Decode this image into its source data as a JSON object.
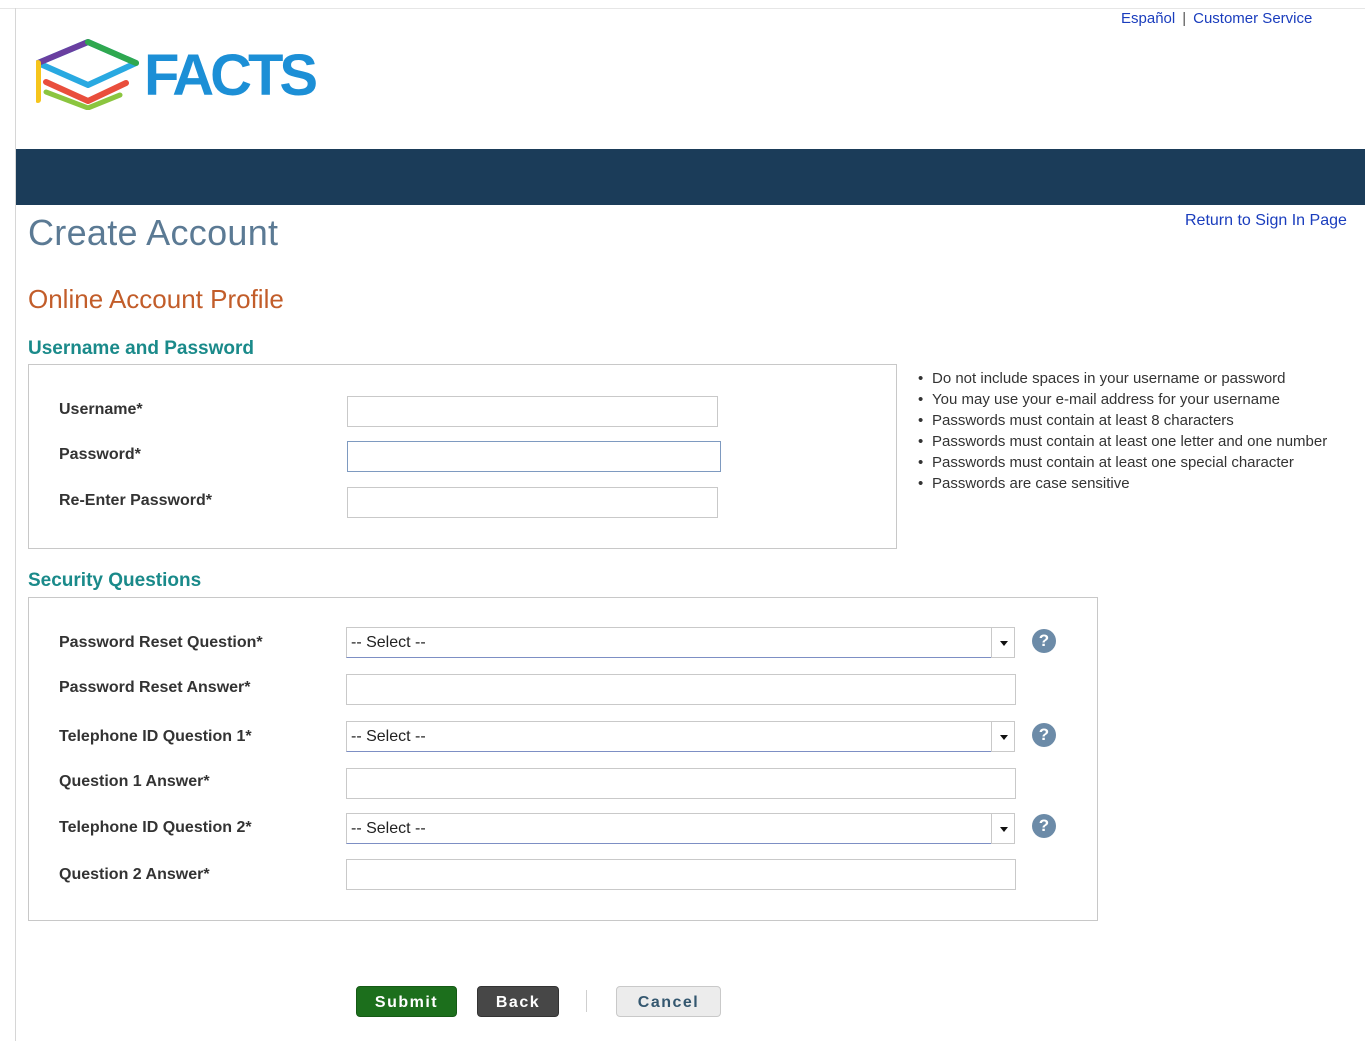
{
  "header": {
    "links": {
      "espanol": "Español",
      "separator": "|",
      "customer_service": "Customer Service"
    },
    "logo_text": "FACTS"
  },
  "page": {
    "title": "Create Account",
    "return_link": "Return to Sign In Page",
    "section_title": "Online Account Profile"
  },
  "username_password": {
    "title": "Username and Password",
    "fields": [
      {
        "label": "Username*",
        "value": ""
      },
      {
        "label": "Password*",
        "value": ""
      },
      {
        "label": "Re-Enter Password*",
        "value": ""
      }
    ],
    "hints": [
      "Do not include spaces in your username or password",
      "You may use your e-mail address for your username",
      "Passwords must contain at least 8 characters",
      "Passwords must contain at least one letter and one number",
      "Passwords must contain at least one special character",
      "Passwords are case sensitive"
    ]
  },
  "security_questions": {
    "title": "Security Questions",
    "help_glyph": "?",
    "rows": [
      {
        "label": "Password Reset Question*",
        "type": "select",
        "value": "-- Select --"
      },
      {
        "label": "Password Reset Answer*",
        "type": "text",
        "value": ""
      },
      {
        "label": "Telephone ID Question 1*",
        "type": "select",
        "value": "-- Select --"
      },
      {
        "label": "Question 1 Answer*",
        "type": "text",
        "value": ""
      },
      {
        "label": "Telephone ID Question 2*",
        "type": "select",
        "value": "-- Select --"
      },
      {
        "label": "Question 2 Answer*",
        "type": "text",
        "value": ""
      }
    ]
  },
  "buttons": {
    "submit": "Submit",
    "back": "Back",
    "cancel": "Cancel"
  },
  "colors": {
    "nav_bar": "#1b3c59",
    "page_title": "#5b7a94",
    "section_title": "#c25d2a",
    "group_title": "#1a8a8a",
    "link": "#1a3dbd",
    "submit": "#1c6f1c",
    "back": "#474747",
    "help_icon": "#6c8ba8"
  }
}
